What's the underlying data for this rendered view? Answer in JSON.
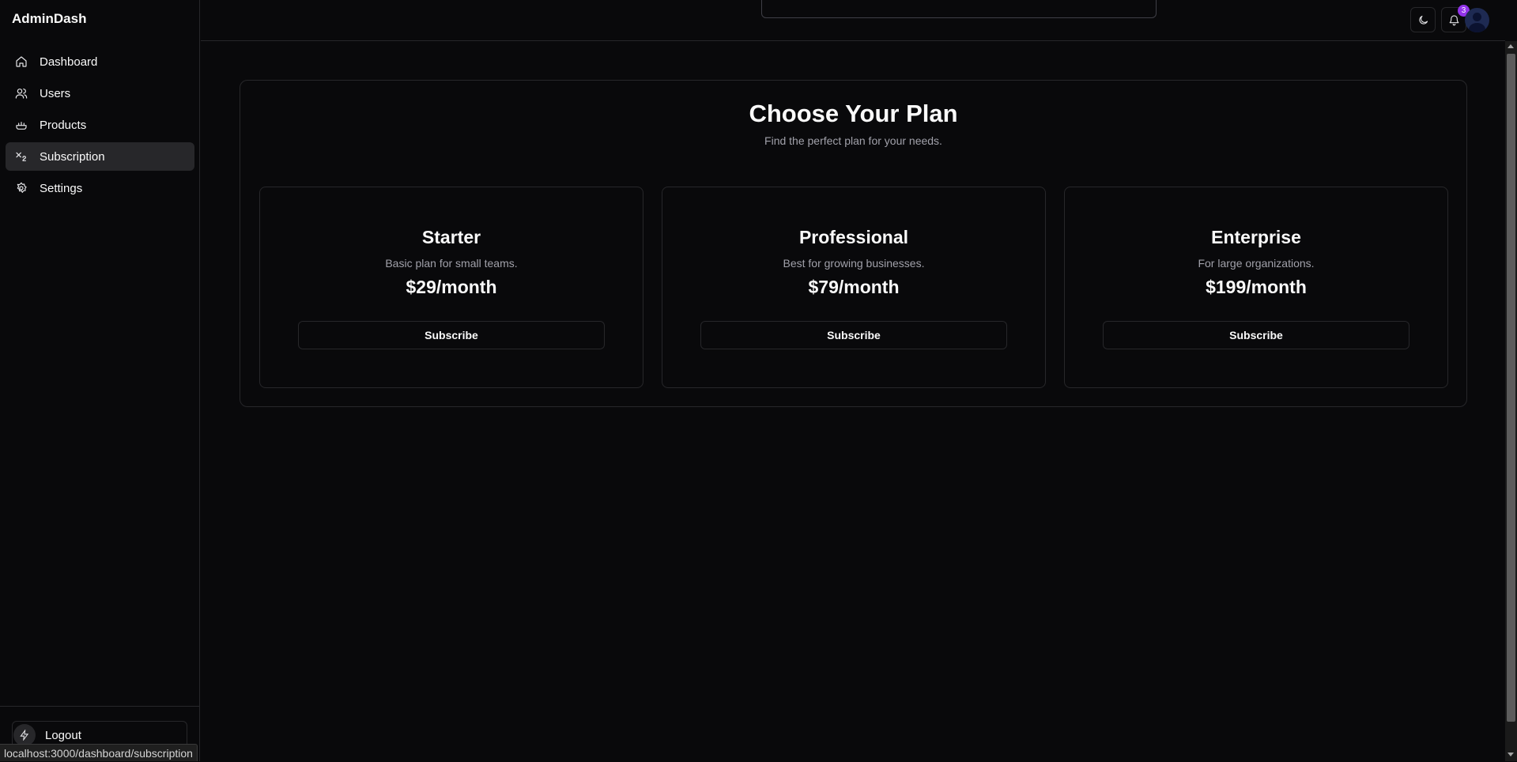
{
  "app": {
    "brand": "AdminDash"
  },
  "sidebar": {
    "items": [
      {
        "label": "Dashboard",
        "icon": "home-icon",
        "active": false
      },
      {
        "label": "Users",
        "icon": "users-icon",
        "active": false
      },
      {
        "label": "Products",
        "icon": "products-icon",
        "active": false
      },
      {
        "label": "Subscription",
        "icon": "subscript-icon",
        "active": true
      },
      {
        "label": "Settings",
        "icon": "gear-icon",
        "active": false
      }
    ],
    "logout_label": "Logout"
  },
  "topbar": {
    "notification_count": "3",
    "icons": [
      "moon-icon",
      "bell-icon",
      "user-avatar-icon"
    ]
  },
  "main": {
    "title": "Choose Your Plan",
    "subtitle": "Find the perfect plan for your needs.",
    "plans": [
      {
        "name": "Starter",
        "description": "Basic plan for small teams.",
        "price": "$29/month",
        "button": "Subscribe"
      },
      {
        "name": "Professional",
        "description": "Best for growing businesses.",
        "price": "$79/month",
        "button": "Subscribe"
      },
      {
        "name": "Enterprise",
        "description": "For large organizations.",
        "price": "$199/month",
        "button": "Subscribe"
      }
    ]
  },
  "statusbar": {
    "url": "localhost:3000/dashboard/subscription"
  },
  "colors": {
    "background": "#09090b",
    "border": "#27272a",
    "active_nav": "#27272a",
    "muted_text": "#a1a1aa",
    "badge": "#9333ea"
  }
}
